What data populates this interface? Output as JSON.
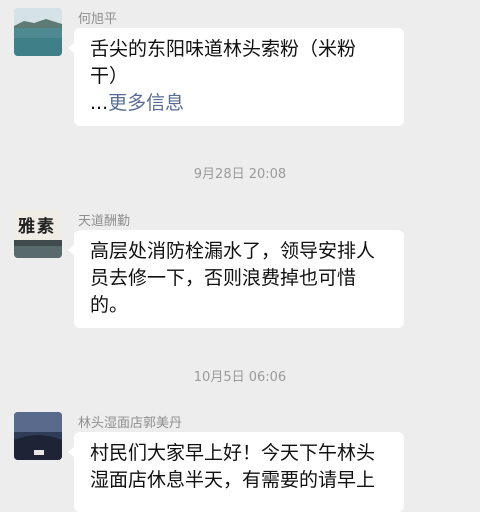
{
  "messages": [
    {
      "sender": "何旭平",
      "text": "舌尖的东阳味道林头索粉（米粉干）",
      "more_prefix": "...",
      "more_link": "更多信息"
    },
    {
      "sender": "天道酬勤",
      "avatar_text": "雅素",
      "text": "高层处消防栓漏水了，领导安排人员去修一下，否则浪费掉也可惜的。"
    },
    {
      "sender": "林头湿面店郭美丹",
      "text": "村民们大家早上好！今天下午林头湿面店休息半天，有需要的请早上"
    }
  ],
  "timestamps": [
    "9月28日 20:08",
    "10月5日 06:06"
  ],
  "colors": {
    "background": "#ededed",
    "bubble": "#ffffff",
    "link": "#576b95"
  }
}
